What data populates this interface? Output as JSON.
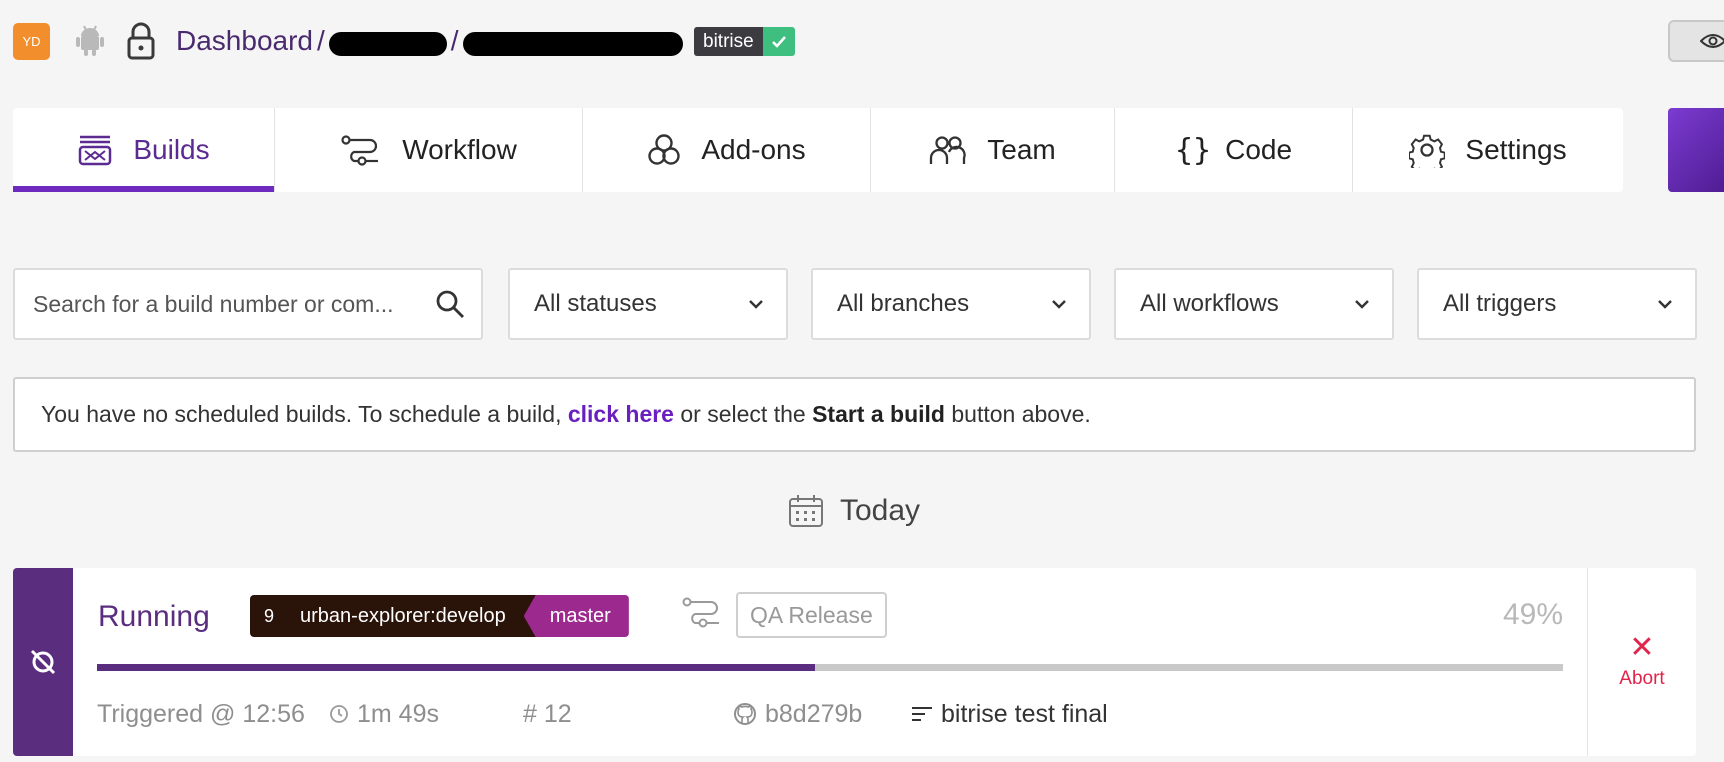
{
  "header": {
    "avatar_initials": "YD",
    "breadcrumb_root": "Dashboard",
    "breadcrumb_sep": "/",
    "stack_badge": "bitrise",
    "icons": [
      "android-icon",
      "lock-icon",
      "check-icon",
      "eye-icon"
    ]
  },
  "tabs": [
    {
      "label": "Builds",
      "icon": "builds-icon",
      "active": true
    },
    {
      "label": "Workflow",
      "icon": "workflow-icon",
      "active": false
    },
    {
      "label": "Add-ons",
      "icon": "addons-icon",
      "active": false
    },
    {
      "label": "Team",
      "icon": "team-icon",
      "active": false
    },
    {
      "label": "Code",
      "icon": "code-icon",
      "active": false
    },
    {
      "label": "Settings",
      "icon": "gear-icon",
      "active": false
    }
  ],
  "filters": {
    "search_placeholder": "Search for a build number or com...",
    "status": "All statuses",
    "branches": "All branches",
    "workflows": "All workflows",
    "triggers": "All triggers"
  },
  "notice": {
    "text_before": "You have no scheduled builds. To schedule a build, ",
    "link": "click here",
    "text_middle": " or select the ",
    "bold": "Start a build",
    "text_after": " button above."
  },
  "date_heading": "Today",
  "build": {
    "status": "Running",
    "number_badge": "9",
    "branch": "urban-explorer:develop",
    "target_branch": "master",
    "workflow": "QA Release",
    "percent_label": "49%",
    "progress": 0.49,
    "triggered": "Triggered @ 12:56",
    "duration": "1m 49s",
    "build_number": "# 12",
    "commit_hash": "b8d279b",
    "commit_message": "bitrise test final",
    "abort_label": "Abort"
  },
  "colors": {
    "accent": "#6f2bbf",
    "running": "#5a2d7f",
    "abort": "#e0244b",
    "badge_ok": "#3fbf7f",
    "avatar": "#f28f2c"
  }
}
